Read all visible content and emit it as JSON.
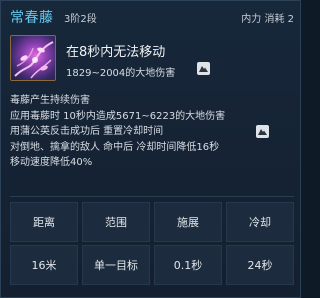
{
  "skill": {
    "name": "常春藤",
    "rank": "3阶2段",
    "cost": "内力 消耗 2"
  },
  "summary": {
    "headline": "在8秒内无法移动",
    "damage": "1829~2004的大地伤害"
  },
  "description": [
    "毒藤产生持续伤害",
    "应用毒藤时 10秒内造成5671~6223的大地伤害",
    "用蒲公英反击成功后 重置冷却时间",
    "对倒地、擒拿的敌人 命中后 冷却时间降低16秒",
    "移动速度降低40%"
  ],
  "stats": [
    {
      "label": "距离",
      "value": "16米"
    },
    {
      "label": "范围",
      "value": "单一目标"
    },
    {
      "label": "施展",
      "value": "0.1秒"
    },
    {
      "label": "冷却",
      "value": "24秒"
    }
  ],
  "colors": {
    "skill_name": "#63c8ee",
    "background": "#152334"
  },
  "icons": {
    "skill": "ivy-skill-icon",
    "element": "earth-element-icon"
  }
}
